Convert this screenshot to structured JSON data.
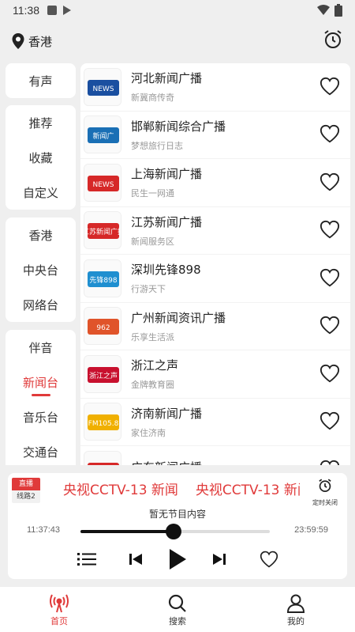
{
  "status_bar": {
    "time": "11:38"
  },
  "header": {
    "location": "香港"
  },
  "categories": {
    "group1": [
      {
        "label": "有声"
      }
    ],
    "group2": [
      {
        "label": "推荐"
      },
      {
        "label": "收藏"
      },
      {
        "label": "自定义"
      }
    ],
    "group3": [
      {
        "label": "香港"
      },
      {
        "label": "中央台"
      },
      {
        "label": "网络台"
      }
    ],
    "group4": [
      {
        "label": "伴音"
      },
      {
        "label": "新闻台"
      },
      {
        "label": "音乐台"
      },
      {
        "label": "交通台"
      }
    ],
    "active": "新闻台"
  },
  "stations": [
    {
      "title": "河北新闻广播",
      "subtitle": "新冀商传奇",
      "logo_text": "NEWS",
      "logo_color": "#1a4fa0"
    },
    {
      "title": "邯郸新闻综合广播",
      "subtitle": "梦想旅行日志",
      "logo_text": "新闻广",
      "logo_color": "#1a6fb5"
    },
    {
      "title": "上海新闻广播",
      "subtitle": "民生一网通",
      "logo_text": "NEWS",
      "logo_color": "#d62828"
    },
    {
      "title": "江苏新闻广播",
      "subtitle": "新闻服务区",
      "logo_text": "江苏新闻广播",
      "logo_color": "#d62828"
    },
    {
      "title": "深圳先锋898",
      "subtitle": "行游天下",
      "logo_text": "先锋898",
      "logo_color": "#1f8fd0"
    },
    {
      "title": "广州新闻资讯广播",
      "subtitle": "乐享生活派",
      "logo_text": "962",
      "logo_color": "#e0542a"
    },
    {
      "title": "浙江之声",
      "subtitle": "金牌教育圈",
      "logo_text": "浙江之声",
      "logo_color": "#c8102e"
    },
    {
      "title": "济南新闻广播",
      "subtitle": "家住济南",
      "logo_text": "FM105.8",
      "logo_color": "#f0b000"
    },
    {
      "title": "广东新闻广播",
      "subtitle": "",
      "logo_text": "广东",
      "logo_color": "#d62828"
    }
  ],
  "player": {
    "badge_live": "直播",
    "badge_line": "线路2",
    "now_playing": "央视CCTV-13 新闻",
    "timer_label": "定时关闭",
    "program_text": "暂无节目内容",
    "time_start": "11:37:43",
    "time_end": "23:59:59",
    "progress_fraction": 0.49
  },
  "bottom_nav": [
    {
      "label": "首页",
      "active": true
    },
    {
      "label": "搜索",
      "active": false
    },
    {
      "label": "我的",
      "active": false
    }
  ],
  "colors": {
    "accent": "#e03a3a",
    "background": "#efefef"
  }
}
